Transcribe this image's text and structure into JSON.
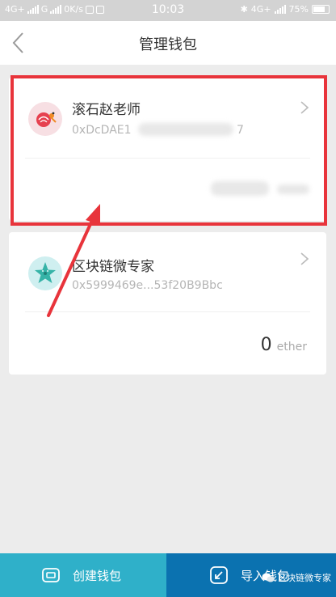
{
  "status_bar": {
    "network1": "4G+",
    "network2": "G",
    "speed": "0K/s",
    "time": "10:03",
    "network3": "4G+",
    "battery": "75%"
  },
  "nav": {
    "title": "管理钱包"
  },
  "wallets": [
    {
      "name": "滚石赵老师",
      "address": "0xDcDAE1",
      "address_tail": "7",
      "balance": "",
      "unit": ""
    },
    {
      "name": "区块链微专家",
      "address": "0x5999469e...53f20B9Bbc",
      "balance": "0",
      "unit": "ether"
    }
  ],
  "bottom": {
    "create_label": "创建钱包",
    "import_label": "导入钱包"
  },
  "watermark": {
    "text": "区块链微专家"
  },
  "colors": {
    "highlight": "#e8343b",
    "create_bg": "#2fb0c9",
    "import_bg": "#0b72b0",
    "status_bg": "#d3d3d3"
  }
}
